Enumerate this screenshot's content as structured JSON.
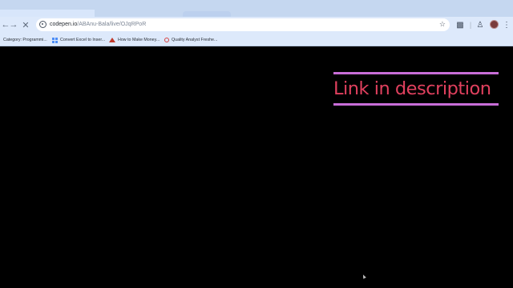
{
  "browser": {
    "address_bar": {
      "domain": "codepen.io",
      "path": "/ABAnu-Bala/live/OJqRPoR"
    },
    "bookmarks": [
      {
        "label": "Category: Programmi...",
        "icon": "none"
      },
      {
        "label": "Convert Excel to Inser...",
        "icon": "grid-icon"
      },
      {
        "label": "How to Make Money...",
        "icon": "hat-icon"
      },
      {
        "label": "Quality Analyst Freshe...",
        "icon": "ring-icon"
      }
    ]
  },
  "page": {
    "promo_text": "Link in description",
    "text_color": "#e0405e",
    "accent_line_color": "#c86dd7",
    "background": "#000000"
  }
}
